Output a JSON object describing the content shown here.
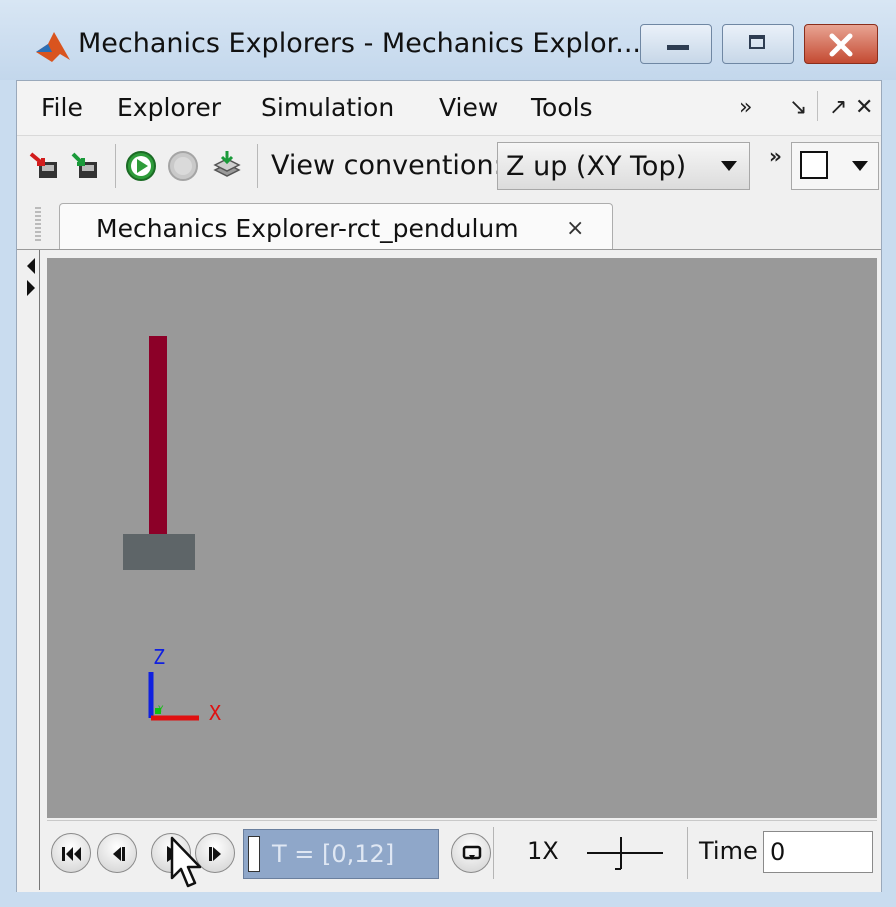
{
  "window": {
    "title": "Mechanics Explorers - Mechanics Explor...",
    "icon": "matlab-logo-icon"
  },
  "menubar": {
    "items": [
      "File",
      "Explorer",
      "Simulation",
      "View",
      "Tools"
    ],
    "overflow": "»",
    "undock": "↘",
    "dock": "↗",
    "close": "✕"
  },
  "toolbar": {
    "view_convention_label": "View convention:",
    "view_convention_value": "Z up (XY Top)",
    "overflow": "»"
  },
  "tab": {
    "label": "Mechanics Explorer-rct_pendulum",
    "close": "×"
  },
  "triad": {
    "z": "Z",
    "y": "Y",
    "x": "X"
  },
  "playback": {
    "time_range": "T = [0,12]",
    "speed": "1X",
    "time_label": "Time",
    "time_value": "0"
  },
  "colors": {
    "rod": "#8c0028",
    "base": "#5e6568",
    "viewport_bg": "#999999",
    "axis_x": "#e01010",
    "axis_y": "#10c010",
    "axis_z": "#1020e0"
  }
}
